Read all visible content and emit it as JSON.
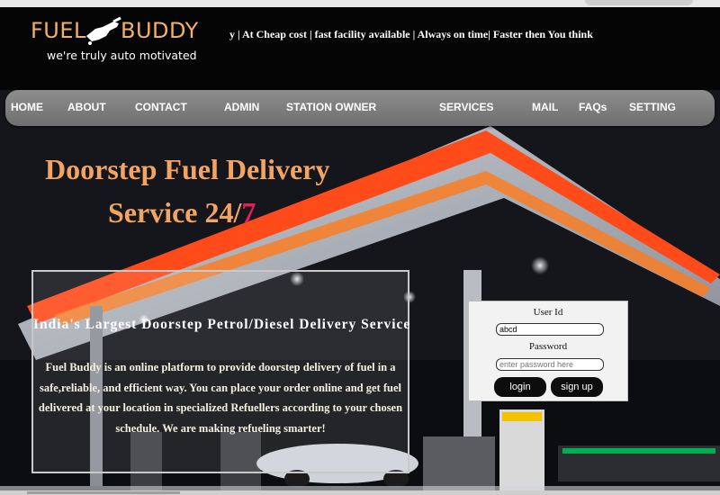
{
  "logo": {
    "left": "FUEL",
    "right": "BUDDY",
    "tagline": "we're truly auto motivated"
  },
  "marquee": "y | At Cheap cost | fast facility available | Always on time| Faster then You think",
  "nav": [
    "HOME",
    "ABOUT",
    "CONTACT",
    "ADMIN",
    "STATION OWNER",
    "SERVICES",
    "MAIL",
    "FAQs",
    "SETTING"
  ],
  "hero": {
    "line1": "Doorstep Fuel Delivery",
    "line2": "Service 24/",
    "line2_accent": "7",
    "info_heading": "India's Largest Doorstep Petrol/Diesel Delivery Service",
    "info_body": "Fuel Buddy is an online platform to provide doorstep delivery of fuel in a safe,reliable, and efficient way. You can place your order online and get fuel delivered at your location in specialized Refuellers according to your chosen schedule. We are making refueling smarter!"
  },
  "login": {
    "userid_label": "User Id",
    "userid_value": "abcd",
    "password_label": "Password",
    "password_placeholder": "enter password here",
    "login_label": "login",
    "signup_label": "sign up"
  },
  "colors": {
    "brand": "#f3b06a",
    "title": "#f3a463",
    "accent": "#e0205a",
    "canopy_red": "#ff3b1a",
    "canopy_orange": "#ff7a1a"
  }
}
